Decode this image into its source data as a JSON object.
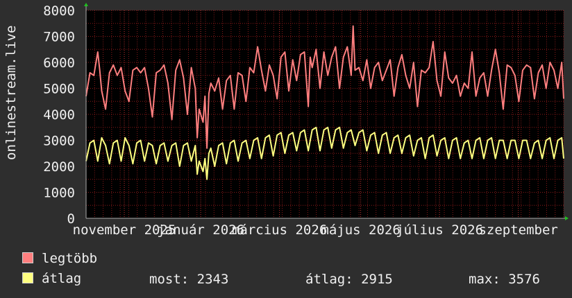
{
  "chart_data": {
    "type": "line",
    "ylabel": "onlinestream.live",
    "ylim": [
      0,
      8000
    ],
    "yticks": [
      "8000",
      "7000",
      "6000",
      "5000",
      "4000",
      "3000",
      "2000",
      "1000",
      "0"
    ],
    "ytick_values": [
      8000,
      7000,
      6000,
      5000,
      4000,
      3000,
      2000,
      1000,
      0
    ],
    "xticks": [
      {
        "label": "november 2025",
        "t": 0.08
      },
      {
        "label": "január 2026",
        "t": 0.24
      },
      {
        "label": "március 2026",
        "t": 0.405
      },
      {
        "label": "május 2026",
        "t": 0.575
      },
      {
        "label": "július 2026",
        "t": 0.74
      },
      {
        "label": "szeptember",
        "t": 0.905
      }
    ],
    "colors": {
      "legtobb": "#ff7f7f",
      "atlag": "#ffff80",
      "grid": "#8b1a1a",
      "axis": "#aaaaaa",
      "background": "#000000"
    },
    "series": [
      {
        "name": "legtöbb",
        "key": "legtobb",
        "points": [
          [
            0,
            4700
          ],
          [
            0.01,
            5600
          ],
          [
            0.02,
            5500
          ],
          [
            0.03,
            6400
          ],
          [
            0.035,
            5700
          ],
          [
            0.04,
            4900
          ],
          [
            0.05,
            4200
          ],
          [
            0.06,
            5600
          ],
          [
            0.07,
            5900
          ],
          [
            0.08,
            5500
          ],
          [
            0.09,
            5800
          ],
          [
            0.1,
            4900
          ],
          [
            0.11,
            4500
          ],
          [
            0.12,
            5700
          ],
          [
            0.13,
            5800
          ],
          [
            0.14,
            5600
          ],
          [
            0.15,
            5800
          ],
          [
            0.16,
            5000
          ],
          [
            0.17,
            3900
          ],
          [
            0.18,
            5600
          ],
          [
            0.19,
            5700
          ],
          [
            0.2,
            5900
          ],
          [
            0.21,
            5200
          ],
          [
            0.22,
            3800
          ],
          [
            0.23,
            5700
          ],
          [
            0.24,
            6100
          ],
          [
            0.25,
            5400
          ],
          [
            0.26,
            4000
          ],
          [
            0.27,
            5800
          ],
          [
            0.28,
            5000
          ],
          [
            0.285,
            3100
          ],
          [
            0.29,
            4200
          ],
          [
            0.3,
            3700
          ],
          [
            0.305,
            4700
          ],
          [
            0.31,
            2700
          ],
          [
            0.315,
            4800
          ],
          [
            0.32,
            5200
          ],
          [
            0.33,
            4900
          ],
          [
            0.34,
            5400
          ],
          [
            0.35,
            4200
          ],
          [
            0.36,
            5300
          ],
          [
            0.37,
            5500
          ],
          [
            0.38,
            4200
          ],
          [
            0.39,
            5600
          ],
          [
            0.4,
            5500
          ],
          [
            0.41,
            4500
          ],
          [
            0.42,
            5800
          ],
          [
            0.43,
            5600
          ],
          [
            0.44,
            6600
          ],
          [
            0.45,
            5700
          ],
          [
            0.46,
            4900
          ],
          [
            0.47,
            5900
          ],
          [
            0.48,
            5500
          ],
          [
            0.49,
            4600
          ],
          [
            0.5,
            6200
          ],
          [
            0.51,
            6400
          ],
          [
            0.52,
            4900
          ],
          [
            0.53,
            6100
          ],
          [
            0.54,
            5300
          ],
          [
            0.55,
            6300
          ],
          [
            0.56,
            6400
          ],
          [
            0.57,
            4300
          ],
          [
            0.575,
            6200
          ],
          [
            0.58,
            5800
          ],
          [
            0.59,
            6500
          ],
          [
            0.6,
            5000
          ],
          [
            0.61,
            6400
          ],
          [
            0.62,
            5500
          ],
          [
            0.63,
            6200
          ],
          [
            0.64,
            6600
          ],
          [
            0.65,
            5000
          ],
          [
            0.66,
            6200
          ],
          [
            0.67,
            6600
          ],
          [
            0.68,
            5500
          ],
          [
            0.685,
            7400
          ],
          [
            0.69,
            5700
          ],
          [
            0.7,
            5800
          ],
          [
            0.71,
            5300
          ],
          [
            0.72,
            6100
          ],
          [
            0.73,
            5000
          ],
          [
            0.74,
            5800
          ],
          [
            0.75,
            6000
          ],
          [
            0.76,
            5300
          ],
          [
            0.77,
            5700
          ],
          [
            0.78,
            6100
          ],
          [
            0.79,
            4700
          ],
          [
            0.8,
            5800
          ],
          [
            0.81,
            6300
          ],
          [
            0.82,
            5500
          ],
          [
            0.83,
            5000
          ],
          [
            0.84,
            6000
          ],
          [
            0.85,
            4300
          ],
          [
            0.86,
            5700
          ],
          [
            0.87,
            5600
          ],
          [
            0.88,
            5800
          ],
          [
            0.89,
            6800
          ],
          [
            0.9,
            5300
          ],
          [
            0.91,
            4700
          ],
          [
            0.92,
            6400
          ],
          [
            0.93,
            5400
          ],
          [
            0.94,
            5200
          ],
          [
            0.95,
            5500
          ],
          [
            0.96,
            4700
          ],
          [
            0.97,
            5200
          ],
          [
            0.98,
            5000
          ],
          [
            0.99,
            6400
          ],
          [
            1.0,
            4700
          ],
          [
            1.01,
            5400
          ],
          [
            1.02,
            5600
          ],
          [
            1.03,
            4700
          ],
          [
            1.04,
            5700
          ],
          [
            1.05,
            6500
          ],
          [
            1.06,
            5600
          ],
          [
            1.07,
            4200
          ],
          [
            1.08,
            5900
          ],
          [
            1.09,
            5800
          ],
          [
            1.1,
            5500
          ],
          [
            1.11,
            4500
          ],
          [
            1.12,
            5700
          ],
          [
            1.13,
            5900
          ],
          [
            1.14,
            5800
          ],
          [
            1.15,
            4600
          ],
          [
            1.16,
            5600
          ],
          [
            1.17,
            5900
          ],
          [
            1.18,
            5000
          ],
          [
            1.19,
            6000
          ],
          [
            1.2,
            5700
          ],
          [
            1.21,
            5000
          ],
          [
            1.22,
            6000
          ],
          [
            1.225,
            4600
          ]
        ]
      },
      {
        "name": "átlag",
        "key": "atlag",
        "points": [
          [
            0,
            2200
          ],
          [
            0.01,
            2900
          ],
          [
            0.02,
            3000
          ],
          [
            0.03,
            2200
          ],
          [
            0.04,
            3100
          ],
          [
            0.05,
            2800
          ],
          [
            0.06,
            2100
          ],
          [
            0.07,
            2900
          ],
          [
            0.08,
            3000
          ],
          [
            0.09,
            2200
          ],
          [
            0.1,
            3100
          ],
          [
            0.11,
            2800
          ],
          [
            0.12,
            2100
          ],
          [
            0.13,
            2900
          ],
          [
            0.14,
            3000
          ],
          [
            0.15,
            2200
          ],
          [
            0.16,
            2900
          ],
          [
            0.17,
            2800
          ],
          [
            0.18,
            2100
          ],
          [
            0.19,
            2800
          ],
          [
            0.2,
            2900
          ],
          [
            0.21,
            2200
          ],
          [
            0.22,
            2800
          ],
          [
            0.23,
            2900
          ],
          [
            0.24,
            2000
          ],
          [
            0.25,
            2800
          ],
          [
            0.26,
            2900
          ],
          [
            0.27,
            2200
          ],
          [
            0.28,
            2800
          ],
          [
            0.285,
            1700
          ],
          [
            0.29,
            2200
          ],
          [
            0.3,
            1800
          ],
          [
            0.305,
            2300
          ],
          [
            0.31,
            1500
          ],
          [
            0.315,
            2500
          ],
          [
            0.32,
            2700
          ],
          [
            0.33,
            2000
          ],
          [
            0.34,
            2800
          ],
          [
            0.35,
            2900
          ],
          [
            0.36,
            2100
          ],
          [
            0.37,
            2900
          ],
          [
            0.38,
            3000
          ],
          [
            0.39,
            2200
          ],
          [
            0.4,
            2900
          ],
          [
            0.41,
            3000
          ],
          [
            0.42,
            2300
          ],
          [
            0.43,
            3000
          ],
          [
            0.44,
            3100
          ],
          [
            0.45,
            2300
          ],
          [
            0.46,
            3100
          ],
          [
            0.47,
            3200
          ],
          [
            0.48,
            2400
          ],
          [
            0.49,
            3200
          ],
          [
            0.5,
            3300
          ],
          [
            0.51,
            2500
          ],
          [
            0.52,
            3200
          ],
          [
            0.53,
            3300
          ],
          [
            0.54,
            2600
          ],
          [
            0.55,
            3300
          ],
          [
            0.56,
            3400
          ],
          [
            0.57,
            2600
          ],
          [
            0.58,
            3400
          ],
          [
            0.59,
            3500
          ],
          [
            0.6,
            2600
          ],
          [
            0.61,
            3400
          ],
          [
            0.62,
            3500
          ],
          [
            0.63,
            2700
          ],
          [
            0.64,
            3400
          ],
          [
            0.65,
            3500
          ],
          [
            0.66,
            2700
          ],
          [
            0.67,
            3300
          ],
          [
            0.68,
            3400
          ],
          [
            0.69,
            2800
          ],
          [
            0.7,
            3300
          ],
          [
            0.71,
            3400
          ],
          [
            0.72,
            2600
          ],
          [
            0.73,
            3200
          ],
          [
            0.74,
            3300
          ],
          [
            0.75,
            2500
          ],
          [
            0.76,
            3200
          ],
          [
            0.77,
            3300
          ],
          [
            0.78,
            2500
          ],
          [
            0.79,
            3100
          ],
          [
            0.8,
            3200
          ],
          [
            0.81,
            2500
          ],
          [
            0.82,
            3100
          ],
          [
            0.83,
            3200
          ],
          [
            0.84,
            2400
          ],
          [
            0.85,
            3000
          ],
          [
            0.86,
            3100
          ],
          [
            0.87,
            2300
          ],
          [
            0.88,
            3100
          ],
          [
            0.89,
            3200
          ],
          [
            0.9,
            2400
          ],
          [
            0.91,
            3000
          ],
          [
            0.92,
            3100
          ],
          [
            0.93,
            2300
          ],
          [
            0.94,
            3000
          ],
          [
            0.95,
            3100
          ],
          [
            0.96,
            2300
          ],
          [
            0.97,
            2900
          ],
          [
            0.98,
            3000
          ],
          [
            0.99,
            2300
          ],
          [
            1.0,
            3000
          ],
          [
            1.01,
            3100
          ],
          [
            1.02,
            2300
          ],
          [
            1.03,
            3000
          ],
          [
            1.04,
            3100
          ],
          [
            1.05,
            2300
          ],
          [
            1.06,
            3000
          ],
          [
            1.07,
            3000
          ],
          [
            1.08,
            2300
          ],
          [
            1.09,
            3000
          ],
          [
            1.1,
            3000
          ],
          [
            1.11,
            2300
          ],
          [
            1.12,
            3000
          ],
          [
            1.13,
            3000
          ],
          [
            1.14,
            2300
          ],
          [
            1.15,
            2900
          ],
          [
            1.16,
            3000
          ],
          [
            1.17,
            2300
          ],
          [
            1.18,
            3000
          ],
          [
            1.19,
            3100
          ],
          [
            1.2,
            2300
          ],
          [
            1.21,
            3000
          ],
          [
            1.22,
            3100
          ],
          [
            1.225,
            2300
          ]
        ]
      }
    ]
  },
  "legend": {
    "max_label": "legtöbb",
    "avg_label": "átlag"
  },
  "stats": {
    "most": "most: 2343",
    "atlag": "átlag: 2915",
    "max": "max: 3576"
  }
}
